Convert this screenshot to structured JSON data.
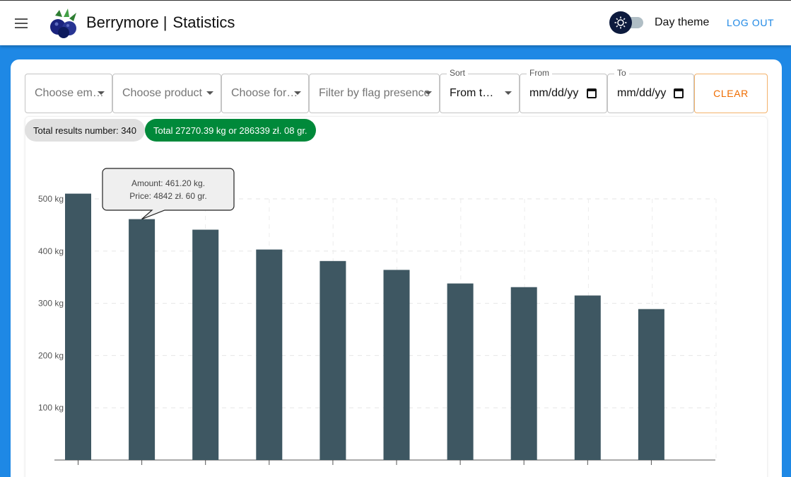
{
  "header": {
    "app_name": "Berrymore",
    "separator": "|",
    "page_title": "Statistics",
    "theme_label": "Day theme",
    "logout_label": "LOG OUT",
    "brand_color": "#1e88e5"
  },
  "filters": {
    "employee": "Choose em…",
    "product": "Choose product",
    "form": "Choose for…",
    "flag": "Filter by flag presence",
    "sort_label": "Sort",
    "sort_value": "From t…",
    "from_label": "From",
    "from_value": "mm/dd/yy",
    "to_label": "To",
    "to_value": "mm/dd/yy",
    "clear_label": "CLEAR"
  },
  "summary": {
    "count": "Total results number: 340",
    "total": "Total 27270.39 kg or 286339 zł. 08 gr."
  },
  "tooltip": {
    "amount": "Amount: 461.20 kg.",
    "price": "Price: 4842 zł. 60 gr."
  },
  "chart_data": {
    "type": "bar",
    "values": [
      510,
      461.2,
      441,
      403,
      381,
      364,
      338,
      331,
      315,
      289
    ],
    "ylim": [
      0,
      550
    ],
    "yticks": [
      100,
      200,
      300,
      400,
      500
    ],
    "ytick_labels": [
      "100 kg",
      "200 kg",
      "300 kg",
      "400 kg",
      "500 kg"
    ],
    "bar_color": "#3e5762",
    "grid": true,
    "tooltip_index": 1
  }
}
